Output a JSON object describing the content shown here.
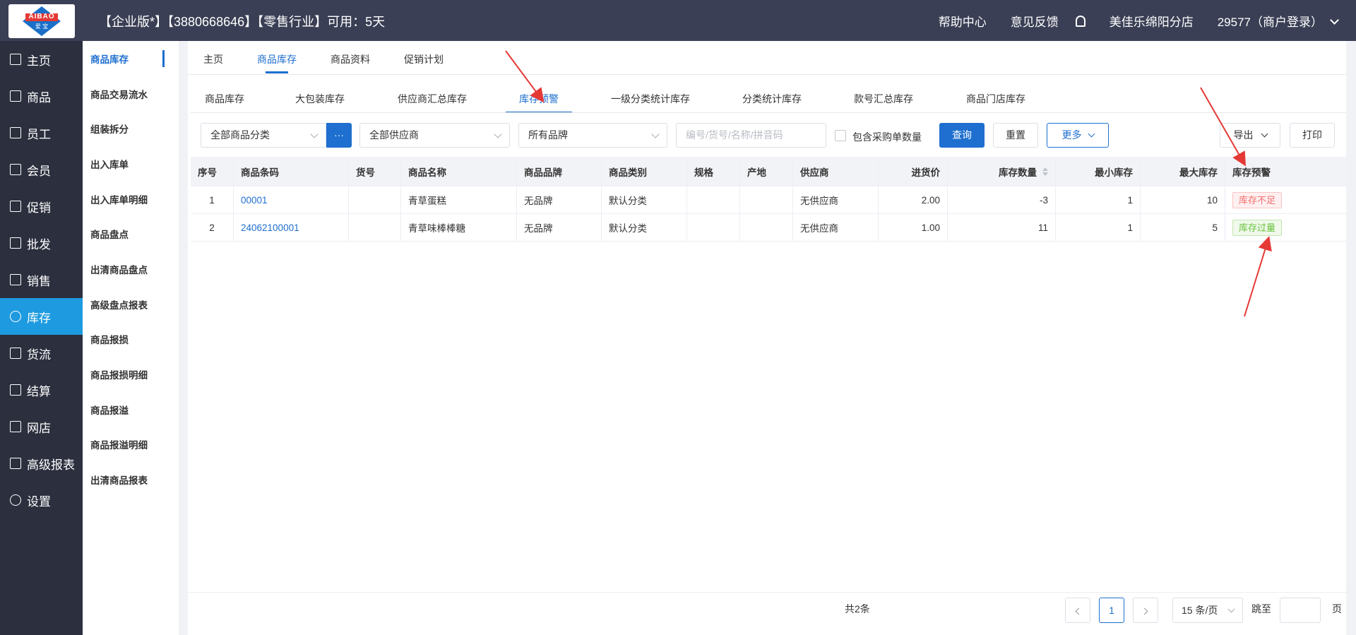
{
  "header": {
    "logo_text": "AIBAO",
    "logo_sub": "爱 宝",
    "title": "【企业版*】【3880668646】【零售行业】可用：5天",
    "help": "帮助中心",
    "feedback": "意见反馈",
    "store": "美佳乐绵阳分店",
    "user": "29577（商户登录）"
  },
  "leftnav": {
    "items": [
      {
        "label": "主页"
      },
      {
        "label": "商品"
      },
      {
        "label": "员工"
      },
      {
        "label": "会员"
      },
      {
        "label": "促销"
      },
      {
        "label": "批发"
      },
      {
        "label": "销售"
      },
      {
        "label": "库存"
      },
      {
        "label": "货流"
      },
      {
        "label": "结算"
      },
      {
        "label": "网店"
      },
      {
        "label": "高级报表"
      },
      {
        "label": "设置"
      }
    ]
  },
  "subnav": {
    "items": [
      {
        "label": "商品库存"
      },
      {
        "label": "商品交易流水"
      },
      {
        "label": "组装拆分"
      },
      {
        "label": "出入库单"
      },
      {
        "label": "出入库单明细"
      },
      {
        "label": "商品盘点"
      },
      {
        "label": "出清商品盘点"
      },
      {
        "label": "高级盘点报表"
      },
      {
        "label": "商品报损"
      },
      {
        "label": "商品报损明细"
      },
      {
        "label": "商品报溢"
      },
      {
        "label": "商品报溢明细"
      },
      {
        "label": "出清商品报表"
      }
    ]
  },
  "tabs1": [
    "主页",
    "商品库存",
    "商品资料",
    "促销计划"
  ],
  "tabs2": [
    "商品库存",
    "大包装库存",
    "供应商汇总库存",
    "库存预警",
    "一级分类统计库存",
    "分类统计库存",
    "款号汇总库存",
    "商品门店库存"
  ],
  "filters": {
    "category": "全部商品分类",
    "category_more": "···",
    "supplier": "全部供应商",
    "brand": "所有品牌",
    "search_placeholder": "编号/货号/名称/拼音码",
    "include_po": "包含采购单数量",
    "query": "查询",
    "reset": "重置",
    "more": "更多",
    "export": "导出",
    "print": "打印"
  },
  "table": {
    "headers": [
      "序号",
      "商品条码",
      "货号",
      "商品名称",
      "商品品牌",
      "商品类别",
      "规格",
      "产地",
      "供应商",
      "进货价",
      "库存数量",
      "最小库存",
      "最大库存",
      "库存预警"
    ],
    "rows": [
      {
        "no": "1",
        "barcode": "00001",
        "sku": "",
        "name": "青草蛋糕",
        "brand": "无品牌",
        "category": "默认分类",
        "spec": "",
        "origin": "",
        "supplier": "无供应商",
        "price": "2.00",
        "stock": "-3",
        "min": "1",
        "max": "10",
        "alert": "库存不足"
      },
      {
        "no": "2",
        "barcode": "24062100001",
        "sku": "",
        "name": "青草味棒棒糖",
        "brand": "无品牌",
        "category": "默认分类",
        "spec": "",
        "origin": "",
        "supplier": "无供应商",
        "price": "1.00",
        "stock": "11",
        "min": "1",
        "max": "5",
        "alert": "库存过量"
      }
    ]
  },
  "pager": {
    "total": "共2条",
    "current": "1",
    "page_size": "15 条/页",
    "jump": "跳至",
    "page_unit": "页"
  },
  "colors": {
    "accent": "#1e6fcf",
    "nav_active": "#1e9be0",
    "warn_red": "#f56c6c",
    "warn_green": "#67c23a",
    "annotation": "#e53935"
  }
}
